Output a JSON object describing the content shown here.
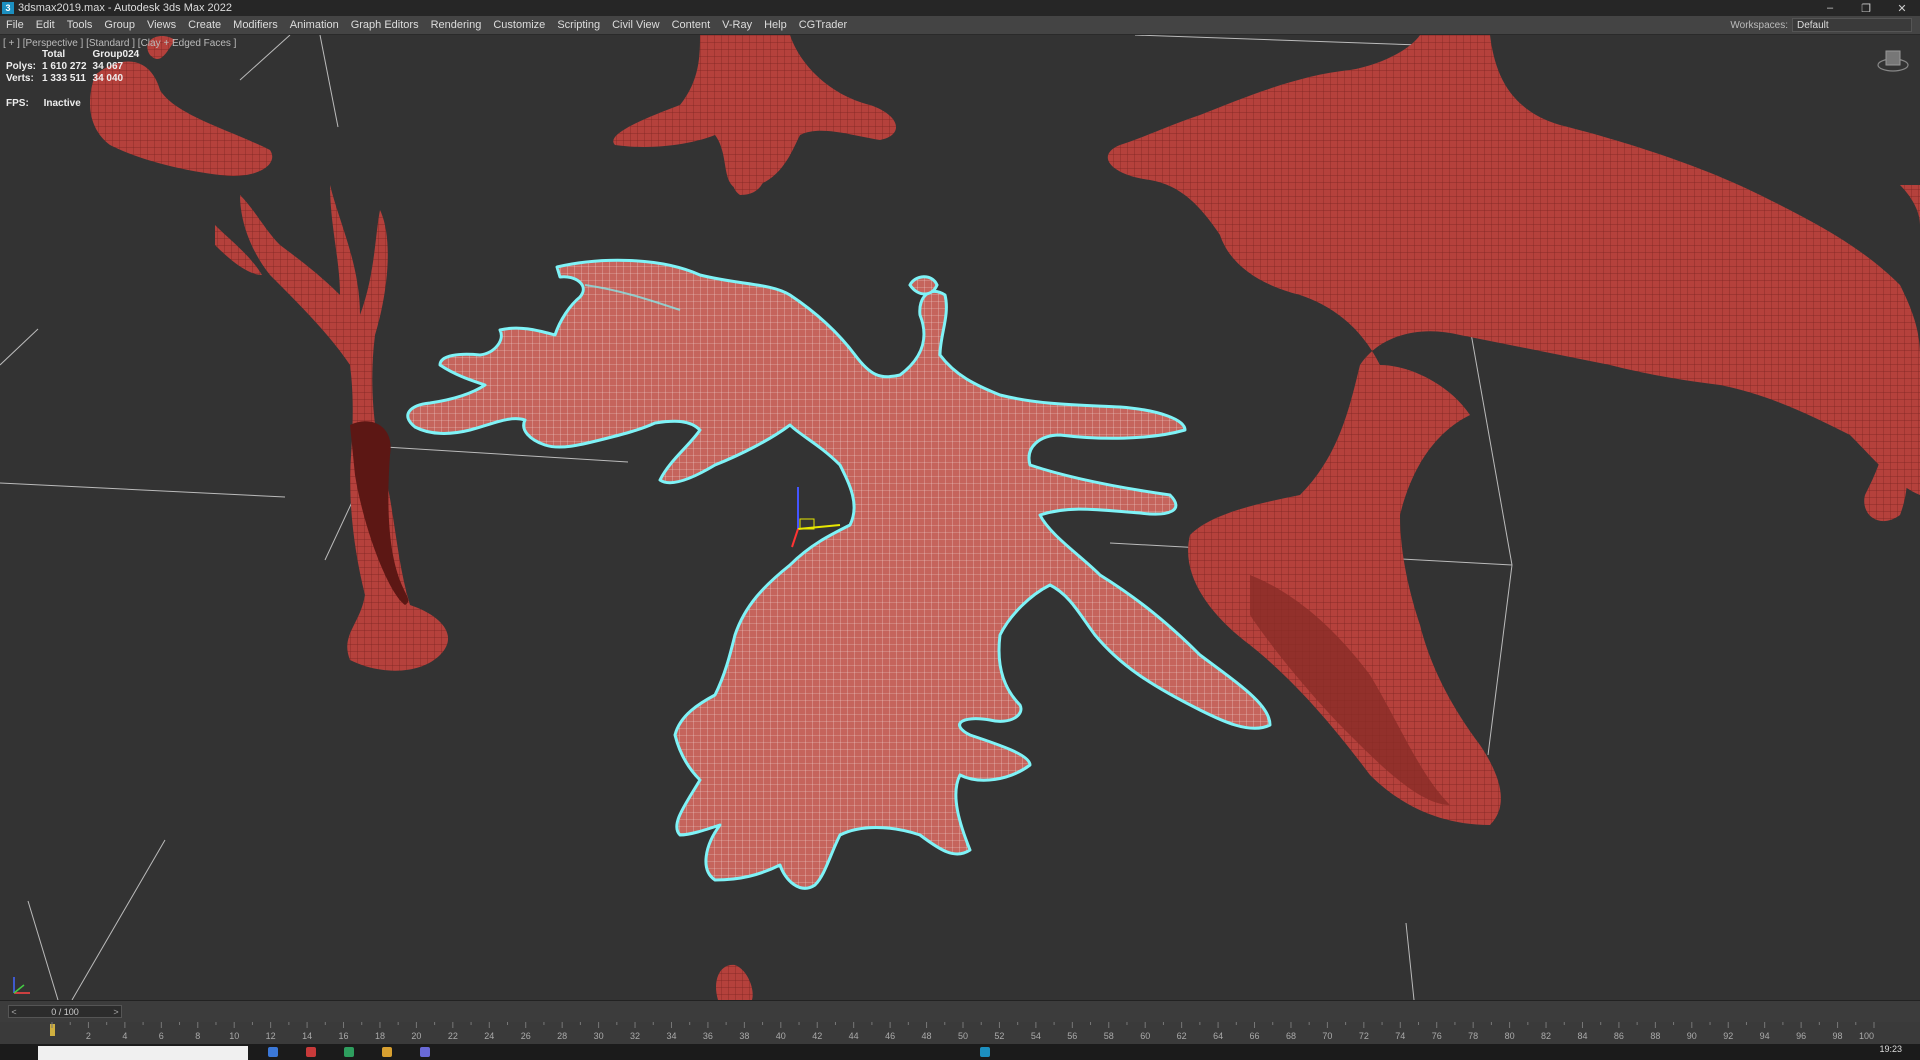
{
  "window": {
    "title": "3dsmax2019.max - Autodesk 3ds Max 2022",
    "controls": [
      "–",
      "❐",
      "✕"
    ]
  },
  "menu": [
    "File",
    "Edit",
    "Tools",
    "Group",
    "Views",
    "Create",
    "Modifiers",
    "Animation",
    "Graph Editors",
    "Rendering",
    "Customize",
    "Scripting",
    "Civil View",
    "Content",
    "V-Ray",
    "Help",
    "CGTrader"
  ],
  "workspaces": {
    "label": "Workspaces:",
    "value": "Default"
  },
  "viewport": {
    "label": "[ + ] [Perspective ] [Standard ] [Clay + Edged Faces ]",
    "stats": {
      "col_total": "Total",
      "col_object": "Group024",
      "polys_label": "Polys:",
      "polys_total": "1 610 272",
      "polys_object": "34 067",
      "verts_label": "Verts:",
      "verts_total": "1 333 511",
      "verts_object": "34 040"
    },
    "fps": {
      "label": "FPS:",
      "value": "Inactive"
    }
  },
  "time_slider": {
    "value": "0 / 100",
    "prev": "<",
    "next": ">"
  },
  "trackbar": {
    "ticks": [
      "2",
      "4",
      "6",
      "8",
      "10",
      "12",
      "14",
      "16",
      "18",
      "20",
      "22",
      "24",
      "26",
      "28",
      "30",
      "32",
      "34",
      "36",
      "38",
      "40",
      "42",
      "44",
      "46",
      "48",
      "50",
      "52",
      "54",
      "56",
      "58",
      "60",
      "62",
      "64",
      "66",
      "68",
      "70",
      "72",
      "74",
      "76",
      "78",
      "80",
      "82",
      "84",
      "86",
      "88",
      "90",
      "92",
      "94",
      "96",
      "98",
      "100"
    ]
  },
  "taskbar": {
    "clock": "19:23"
  },
  "colors": {
    "mesh": "#b5413c",
    "mesh_dark": "#7a2420",
    "selection_outline": "#7ff3f7",
    "viewport_bg": "#333333"
  }
}
